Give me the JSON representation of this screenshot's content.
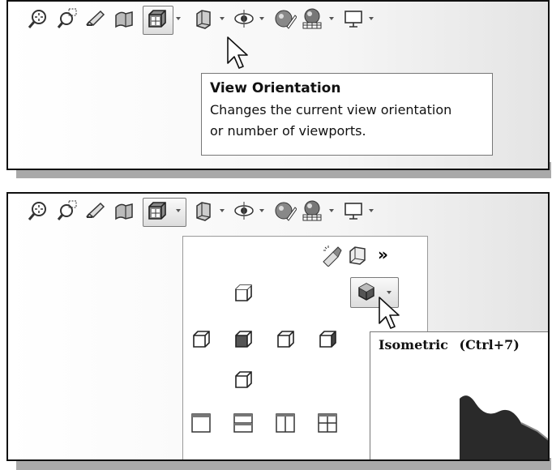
{
  "tooltip1": {
    "title": "View Orientation",
    "line1": "Changes the current view orientation",
    "line2": "or number of viewports."
  },
  "tooltip2": {
    "title": "Isometric",
    "shortcut": "(Ctrl+7)"
  },
  "toolbar": {
    "icons": [
      "zoom-to-fit-icon",
      "zoom-to-area-icon",
      "previous-view-icon",
      "section-view-icon",
      "view-orientation-icon",
      "display-style-icon",
      "hide-show-items-icon",
      "edit-appearance-icon",
      "apply-scene-icon",
      "view-settings-icon"
    ]
  },
  "menu": {
    "expand_glyph": "»",
    "views": [
      "top",
      "isometric",
      "left",
      "front",
      "right",
      "back",
      "bottom"
    ],
    "viewport_layouts": [
      "single-view",
      "two-view-horizontal",
      "two-view-vertical",
      "four-view"
    ]
  },
  "colors": {
    "border": "#111111",
    "shadow": "#a9a9a9"
  }
}
